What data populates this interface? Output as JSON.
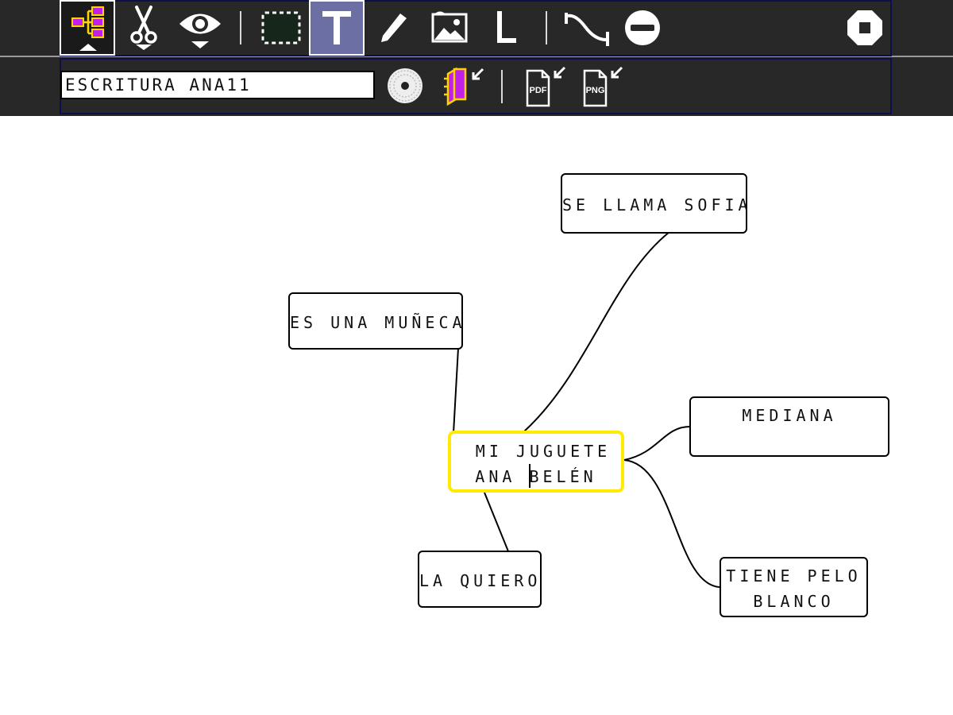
{
  "window": {
    "title": "ESCRITURA ANA11"
  },
  "toolbar": {
    "tools": [
      {
        "name": "mindmap-tool",
        "icon": "mindmap-icon",
        "active": true
      },
      {
        "name": "cut-tool",
        "icon": "scissors-icon"
      },
      {
        "name": "view-tool",
        "icon": "eye-icon"
      },
      {
        "name": "select-tool",
        "icon": "dashed-rect-icon"
      },
      {
        "name": "text-tool",
        "icon": "text-T-icon",
        "selected": true
      },
      {
        "name": "pencil-tool",
        "icon": "pencil-icon"
      },
      {
        "name": "image-tool",
        "icon": "image-icon"
      },
      {
        "name": "line-tool",
        "icon": "L-icon"
      },
      {
        "name": "curve-tool",
        "icon": "curve-icon"
      },
      {
        "name": "remove-tool",
        "icon": "minus-circle-icon"
      },
      {
        "name": "stop-tool",
        "icon": "stop-icon"
      }
    ],
    "colors": {
      "accent_selected": "#6b6fa3",
      "node_highlight": "#ffea00",
      "icon_fill": "#c020e8"
    }
  },
  "secondary_toolbar": {
    "title_input_value": "ESCRITURA ANA11",
    "pdf_label": "PDF",
    "png_label": "PNG"
  },
  "mindmap": {
    "center": {
      "lines": [
        "MI JUGUETE",
        "ANA ",
        "BELÉN"
      ]
    },
    "nodes": [
      {
        "id": "n1",
        "lines": [
          "SE LLAMA SOFIA"
        ]
      },
      {
        "id": "n2",
        "lines": [
          "ES UNA MUÑECA"
        ]
      },
      {
        "id": "n3",
        "lines": [
          "MEDIANA"
        ]
      },
      {
        "id": "n4",
        "lines": [
          "LA QUIERO"
        ]
      },
      {
        "id": "n5",
        "lines": [
          "TIENE PELO",
          "BLANCO"
        ]
      }
    ]
  }
}
